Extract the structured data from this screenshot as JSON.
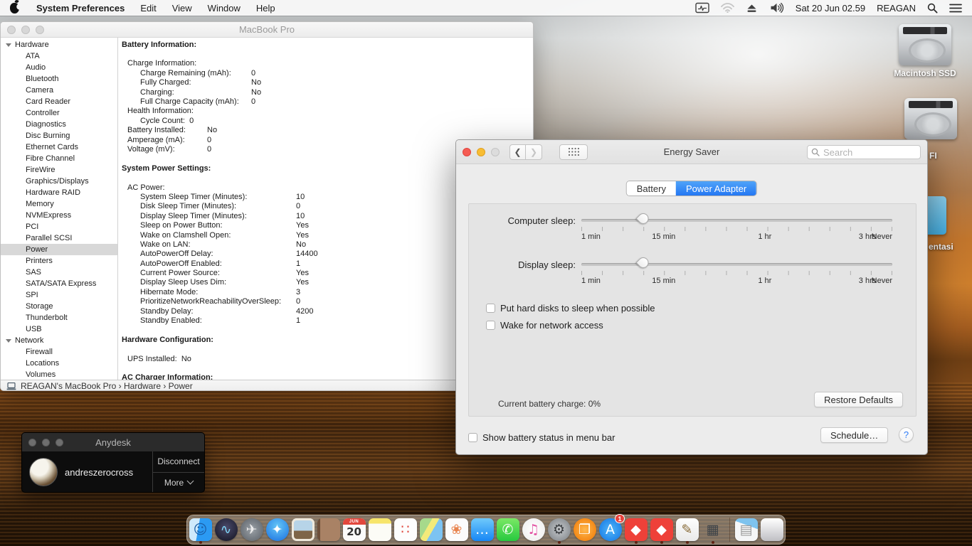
{
  "menu_bar": {
    "app_name": "System Preferences",
    "menus": [
      "Edit",
      "View",
      "Window",
      "Help"
    ],
    "status": {
      "clock": "Sat 20 Jun 02.59",
      "user": "REAGAN"
    }
  },
  "system_info": {
    "title": "MacBook Pro",
    "sidebar": [
      {
        "label": "Hardware",
        "group": true
      },
      {
        "label": "ATA"
      },
      {
        "label": "Audio"
      },
      {
        "label": "Bluetooth"
      },
      {
        "label": "Camera"
      },
      {
        "label": "Card Reader"
      },
      {
        "label": "Controller"
      },
      {
        "label": "Diagnostics"
      },
      {
        "label": "Disc Burning"
      },
      {
        "label": "Ethernet Cards"
      },
      {
        "label": "Fibre Channel"
      },
      {
        "label": "FireWire"
      },
      {
        "label": "Graphics/Displays"
      },
      {
        "label": "Hardware RAID"
      },
      {
        "label": "Memory"
      },
      {
        "label": "NVMExpress"
      },
      {
        "label": "PCI"
      },
      {
        "label": "Parallel SCSI"
      },
      {
        "label": "Power",
        "selected": true
      },
      {
        "label": "Printers"
      },
      {
        "label": "SAS"
      },
      {
        "label": "SATA/SATA Express"
      },
      {
        "label": "SPI"
      },
      {
        "label": "Storage"
      },
      {
        "label": "Thunderbolt"
      },
      {
        "label": "USB"
      },
      {
        "label": "Network",
        "group": true
      },
      {
        "label": "Firewall"
      },
      {
        "label": "Locations"
      },
      {
        "label": "Volumes"
      }
    ],
    "content_rows": [
      {
        "t": "Battery Information:",
        "b": true
      },
      {
        "t": ""
      },
      {
        "t": "Charge Information:",
        "ind": 1
      },
      {
        "t": "Charge Remaining (mAh):",
        "v": "0",
        "ind": 2,
        "col": "a"
      },
      {
        "t": "Fully Charged:",
        "v": "No",
        "ind": 2,
        "col": "a"
      },
      {
        "t": "Charging:",
        "v": "No",
        "ind": 2,
        "col": "a"
      },
      {
        "t": "Full Charge Capacity (mAh):",
        "v": "0",
        "ind": 2,
        "col": "a"
      },
      {
        "t": "Health Information:",
        "ind": 1
      },
      {
        "t": "Cycle Count:  0",
        "ind": 2
      },
      {
        "t": "Battery Installed:",
        "v": "No",
        "ind": 1,
        "col": "b"
      },
      {
        "t": "Amperage (mA):",
        "v": "0",
        "ind": 1,
        "col": "b"
      },
      {
        "t": "Voltage (mV):",
        "v": "0",
        "ind": 1,
        "col": "b"
      },
      {
        "t": ""
      },
      {
        "t": "System Power Settings:",
        "b": true
      },
      {
        "t": ""
      },
      {
        "t": "AC Power:",
        "ind": 1
      },
      {
        "t": "System Sleep Timer (Minutes):",
        "v": "10",
        "ind": 2,
        "col": "c"
      },
      {
        "t": "Disk Sleep Timer (Minutes):",
        "v": "0",
        "ind": 2,
        "col": "c"
      },
      {
        "t": "Display Sleep Timer (Minutes):",
        "v": "10",
        "ind": 2,
        "col": "c"
      },
      {
        "t": "Sleep on Power Button:",
        "v": "Yes",
        "ind": 2,
        "col": "c"
      },
      {
        "t": "Wake on Clamshell Open:",
        "v": "Yes",
        "ind": 2,
        "col": "c"
      },
      {
        "t": "Wake on LAN:",
        "v": "No",
        "ind": 2,
        "col": "c"
      },
      {
        "t": "AutoPowerOff Delay:",
        "v": "14400",
        "ind": 2,
        "col": "c"
      },
      {
        "t": "AutoPowerOff Enabled:",
        "v": "1",
        "ind": 2,
        "col": "c"
      },
      {
        "t": "Current Power Source:",
        "v": "Yes",
        "ind": 2,
        "col": "c"
      },
      {
        "t": "Display Sleep Uses Dim:",
        "v": "Yes",
        "ind": 2,
        "col": "c"
      },
      {
        "t": "Hibernate Mode:",
        "v": "3",
        "ind": 2,
        "col": "c"
      },
      {
        "t": "PrioritizeNetworkReachabilityOverSleep:",
        "v": "0",
        "ind": 2,
        "col": "c"
      },
      {
        "t": "Standby Delay:",
        "v": "4200",
        "ind": 2,
        "col": "c"
      },
      {
        "t": "Standby Enabled:",
        "v": "1",
        "ind": 2,
        "col": "c"
      },
      {
        "t": ""
      },
      {
        "t": "Hardware Configuration:",
        "b": true
      },
      {
        "t": ""
      },
      {
        "t": "UPS Installed:  No",
        "ind": 1
      },
      {
        "t": ""
      },
      {
        "t": "AC Charger Information:",
        "b": true
      }
    ],
    "statusbar_path": "REAGAN's MacBook Pro  ›  Hardware  ›  Power"
  },
  "energy_saver": {
    "title": "Energy Saver",
    "search_placeholder": "Search",
    "tabs": [
      {
        "label": "Battery"
      },
      {
        "label": "Power Adapter",
        "active": true
      }
    ],
    "sliders": [
      {
        "label": "Computer sleep:",
        "pos": "20%"
      },
      {
        "label": "Display sleep:",
        "pos": "20%"
      }
    ],
    "scale": [
      {
        "t": "1 min",
        "p": "0%",
        "a": "left"
      },
      {
        "t": "15 min",
        "p": "26.5%"
      },
      {
        "t": "1 hr",
        "p": "59%"
      },
      {
        "t": "3 hrs",
        "p": "92%"
      },
      {
        "t": "Never",
        "p": "100%",
        "a": "right"
      }
    ],
    "checkboxes": [
      {
        "label": "Put hard disks to sleep when possible"
      },
      {
        "label": "Wake for network access"
      }
    ],
    "battery_status": "Current battery charge: 0%",
    "restore_button": "Restore Defaults",
    "bottom_checkbox": "Show battery status in menu bar",
    "schedule_button": "Schedule…",
    "help_label": "?"
  },
  "anydesk": {
    "title": "Anydesk",
    "user": "andreszerocross",
    "disconnect_label": "Disconnect",
    "more_label": "More"
  },
  "desktop": {
    "disk1_label": "Macintosh SSD",
    "disk2_label": "FI",
    "doc_label": "entasi"
  },
  "dock": {
    "items": [
      {
        "name": "dock-item-finder",
        "glyph": "☺",
        "bg": "linear-gradient(100deg,#cfe9fb 0 40%,#2b9af3 40% 100%)",
        "fg": "#1b5fa8",
        "running": true
      },
      {
        "name": "dock-item-siri",
        "glyph": "∿",
        "bg": "radial-gradient(circle at 50% 40%,#4a4a6a,#121220)",
        "fg": "#7fd4f5",
        "round": true
      },
      {
        "name": "dock-item-launchpad",
        "glyph": "✈",
        "bg": "radial-gradient(circle,#9aa0a6,#595f66)",
        "fg": "#ececec",
        "round": true
      },
      {
        "name": "dock-item-safari",
        "glyph": "✦",
        "bg": "radial-gradient(circle at 50% 35%,#64c6f7,#1a6fe0)",
        "fg": "#ffffff",
        "round": true
      },
      {
        "name": "dock-item-mail",
        "glyph": "",
        "bg": "linear-gradient(180deg,#b7d4e8 0 55%,#7e6548 55% 100%)",
        "shadow": "inset 0 0 0 3px #efe9dc"
      },
      {
        "name": "dock-item-contacts",
        "glyph": "",
        "bg": "linear-gradient(90deg,#6d4f3a 0 12%,#a98265 12% 100%)"
      },
      {
        "name": "dock-item-calendar",
        "glyph": "20",
        "top": "JUN",
        "bg": "#fbfbfb",
        "fg": "#333333"
      },
      {
        "name": "dock-item-notes",
        "glyph": "",
        "bg": "linear-gradient(180deg,#f7e56a 0 24%,#fcfcf6 24% 100%)"
      },
      {
        "name": "dock-item-reminders",
        "glyph": "∷",
        "bg": "#fdfdfd",
        "fg": "#e0493f"
      },
      {
        "name": "dock-item-maps",
        "glyph": "",
        "bg": "linear-gradient(120deg,#a6d98b 0 35%,#f3ea7a 35% 55%,#7cc3f2 55% 100%)"
      },
      {
        "name": "dock-item-photos",
        "glyph": "❀",
        "bg": "#fcfcfc",
        "fg": "#e8844f"
      },
      {
        "name": "dock-item-messages",
        "glyph": "…",
        "bg": "linear-gradient(180deg,#6fc9fb,#1787f5)",
        "fg": "#ffffff"
      },
      {
        "name": "dock-item-facetime",
        "glyph": "✆",
        "bg": "linear-gradient(180deg,#7ae865,#27c93f)",
        "fg": "#ffffff"
      },
      {
        "name": "dock-item-itunes",
        "glyph": "♫",
        "bg": "radial-gradient(circle,#ffffff,#ececec)",
        "fg": "#e254a4",
        "round": true
      },
      {
        "name": "dock-item-system-preferences",
        "glyph": "⚙",
        "bg": "radial-gradient(circle,#c7cacd,#787d82)",
        "fg": "#3a3d40",
        "round": true,
        "running": true
      },
      {
        "name": "dock-item-ibooks",
        "glyph": "❐",
        "bg": "radial-gradient(circle,#ffb84d,#ef7500)",
        "fg": "#ffffff",
        "round": true
      },
      {
        "name": "dock-item-app-store",
        "glyph": "A",
        "bg": "radial-gradient(circle,#4fb6f9,#1173e3)",
        "fg": "#ffffff",
        "round": true,
        "badge": "1"
      },
      {
        "name": "dock-item-anydesk",
        "glyph": "◆",
        "bg": "#ee4139",
        "fg": "#ffffff",
        "running": true
      },
      {
        "name": "dock-item-anydesk-2",
        "glyph": "◆",
        "bg": "#ee4139",
        "fg": "#ffffff",
        "running": true
      },
      {
        "name": "dock-item-textedit",
        "glyph": "✎",
        "bg": "linear-gradient(180deg,#fefefe,#e9e9e9)",
        "fg": "#8a6d3b",
        "running": true
      },
      {
        "name": "dock-item-hardware-tool",
        "glyph": "▦",
        "bg": "transparent",
        "fg": "#3f4449",
        "running": true
      },
      {
        "name": "dock-divider",
        "divider": true
      },
      {
        "name": "dock-item-documents",
        "glyph": "▤",
        "bg": "linear-gradient(200deg,#7ec3ee 0 35%,#f5f6f7 35% 100%)",
        "fg": "#9a9a9a"
      },
      {
        "name": "dock-item-trash",
        "glyph": "",
        "bg": "linear-gradient(180deg,#ffffff,#bfbfc4)"
      }
    ]
  }
}
